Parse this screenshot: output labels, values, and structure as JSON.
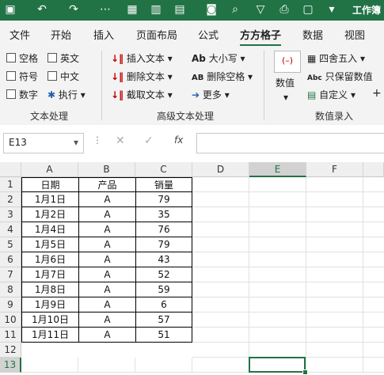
{
  "app": {
    "title": "工作簿"
  },
  "menu": {
    "tabs": [
      "文件",
      "开始",
      "插入",
      "页面布局",
      "公式",
      "方方格子",
      "数据",
      "视图"
    ],
    "active": "方方格子"
  },
  "ribbon": {
    "text_group": {
      "label": "文本处理",
      "options": [
        "空格",
        "英文",
        "符号",
        "中文",
        "数字",
        "执行"
      ]
    },
    "advanced_group": {
      "label": "高级文本处理",
      "buttons": [
        "插入文本",
        "删除文本",
        "截取文本",
        "大小写",
        "删除空格",
        "更多"
      ]
    },
    "data_group": {
      "label": "数值录入",
      "big_button": "数值",
      "buttons": [
        "四舍五入",
        "只保留数值",
        "自定义"
      ]
    }
  },
  "formula_bar": {
    "name_box": "E13",
    "formula": ""
  },
  "sheet": {
    "columns": [
      "A",
      "B",
      "C",
      "D",
      "E",
      "F"
    ],
    "rows": [
      "1",
      "2",
      "3",
      "4",
      "5",
      "6",
      "7",
      "8",
      "9",
      "10",
      "11",
      "12",
      "13"
    ],
    "header": [
      "日期",
      "产品",
      "销量"
    ],
    "data": [
      [
        "1月1日",
        "A",
        "79"
      ],
      [
        "1月2日",
        "A",
        "35"
      ],
      [
        "1月4日",
        "A",
        "76"
      ],
      [
        "1月5日",
        "A",
        "79"
      ],
      [
        "1月6日",
        "A",
        "43"
      ],
      [
        "1月7日",
        "A",
        "52"
      ],
      [
        "1月8日",
        "A",
        "59"
      ],
      [
        "1月9日",
        "A",
        "6"
      ],
      [
        "1月10日",
        "A",
        "57"
      ],
      [
        "1月11日",
        "A",
        "51"
      ]
    ],
    "selected_cell": "E13"
  },
  "colors": {
    "brand": "#217346",
    "ribbon_bg": "#f3f3f3",
    "selection": "#217346"
  }
}
